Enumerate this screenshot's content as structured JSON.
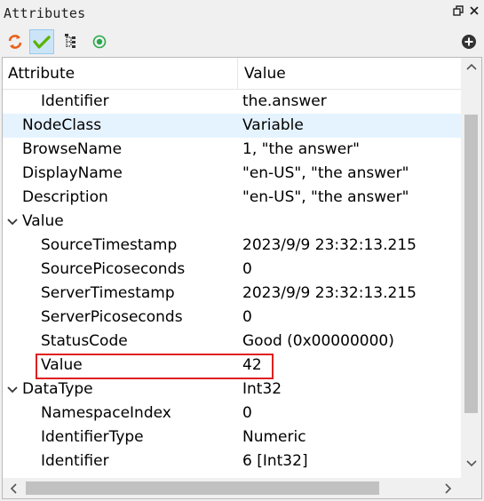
{
  "window": {
    "title": "Attributes"
  },
  "toolbar": {
    "buttons": [
      {
        "name": "refresh-icon"
      },
      {
        "name": "check-icon",
        "active": true
      },
      {
        "name": "tree-structure-icon"
      },
      {
        "name": "record-icon"
      },
      {
        "name": "add-icon"
      }
    ]
  },
  "table": {
    "headers": {
      "attribute": "Attribute",
      "value": "Value"
    },
    "rows": [
      {
        "attribute": "Identifier",
        "value": "the.answer",
        "level": 2
      },
      {
        "attribute": "NodeClass",
        "value": "Variable",
        "level": 1,
        "selected": true
      },
      {
        "attribute": "BrowseName",
        "value": "1, \"the answer\"",
        "level": 1
      },
      {
        "attribute": "DisplayName",
        "value": "\"en-US\", \"the answer\"",
        "level": 1
      },
      {
        "attribute": "Description",
        "value": "\"en-US\", \"the answer\"",
        "level": 1
      },
      {
        "attribute": "Value",
        "value": "",
        "level": 0,
        "expandable": true
      },
      {
        "attribute": "SourceTimestamp",
        "value": "2023/9/9 23:32:13.215",
        "level": 2
      },
      {
        "attribute": "SourcePicoseconds",
        "value": "0",
        "level": 2
      },
      {
        "attribute": "ServerTimestamp",
        "value": "2023/9/9 23:32:13.215",
        "level": 2
      },
      {
        "attribute": "ServerPicoseconds",
        "value": "0",
        "level": 2
      },
      {
        "attribute": "StatusCode",
        "value": "Good (0x00000000)",
        "level": 2
      },
      {
        "attribute": "Value",
        "value": "42",
        "level": 2,
        "highlighted": true
      },
      {
        "attribute": "DataType",
        "value": "Int32",
        "level": 0,
        "expandable": true
      },
      {
        "attribute": "NamespaceIndex",
        "value": "0",
        "level": 2
      },
      {
        "attribute": "IdentifierType",
        "value": "Numeric",
        "level": 2
      },
      {
        "attribute": "Identifier",
        "value": "6 [Int32]",
        "level": 2
      }
    ]
  },
  "colors": {
    "selected_row": "#e5f3ff",
    "highlight_border": "#e0201e",
    "refresh_icon": "#e8621c",
    "check_icon": "#59b300",
    "record_icon": "#2aa84a"
  }
}
